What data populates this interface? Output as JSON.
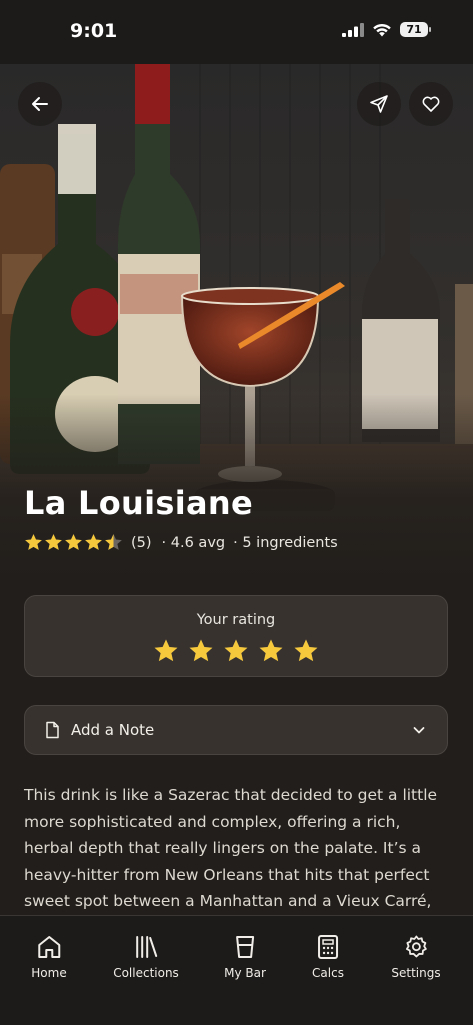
{
  "status_bar": {
    "time": "9:01",
    "battery": "71"
  },
  "hero": {
    "title": "La Louisiane",
    "rating_stars": 4.5,
    "rating_count": "(5)",
    "avg": "· 4.6 avg",
    "ingredients": "· 5 ingredients"
  },
  "header_buttons": {
    "back": "back-arrow-icon",
    "share": "send-icon",
    "favorite": "heart-icon"
  },
  "your_rating": {
    "label": "Your rating",
    "value": 5,
    "max": 5,
    "star_color": "#f6c83b"
  },
  "note": {
    "label": "Add a Note"
  },
  "description": "This drink is like a Sazerac that decided to get a little more sophisticated and complex, offering a rich, herbal depth that really lingers on the palate. It’s a heavy-hitter from New Orleans that hits that perfect sweet spot between a Manhattan and a Vieux Carré, making it",
  "nav": {
    "items": [
      {
        "label": "Home",
        "icon": "home-icon"
      },
      {
        "label": "Collections",
        "icon": "books-icon"
      },
      {
        "label": "My Bar",
        "icon": "glass-icon"
      },
      {
        "label": "Calcs",
        "icon": "calculator-icon"
      },
      {
        "label": "Settings",
        "icon": "gear-icon"
      }
    ]
  }
}
